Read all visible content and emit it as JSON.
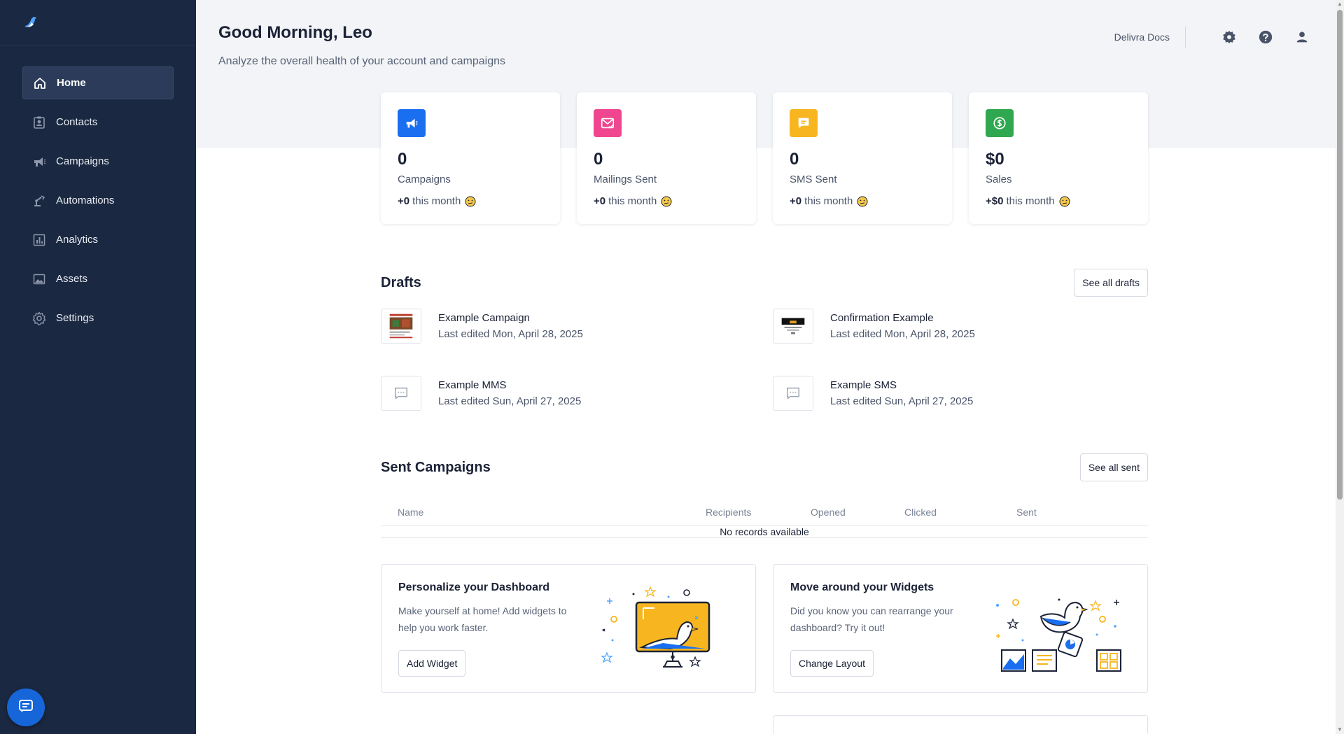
{
  "sidebar": {
    "items": [
      {
        "label": "Home",
        "icon": "home-icon",
        "active": true
      },
      {
        "label": "Contacts",
        "icon": "contacts-icon"
      },
      {
        "label": "Campaigns",
        "icon": "megaphone-icon"
      },
      {
        "label": "Automations",
        "icon": "robot-arm-icon"
      },
      {
        "label": "Analytics",
        "icon": "bar-chart-icon"
      },
      {
        "label": "Assets",
        "icon": "image-icon"
      },
      {
        "label": "Settings",
        "icon": "gear-icon"
      }
    ]
  },
  "header": {
    "greeting": "Good Morning, Leo",
    "subtitle": "Analyze the overall health of your account and campaigns",
    "docs_link": "Delivra Docs"
  },
  "stats": [
    {
      "value": "0",
      "label": "Campaigns",
      "delta": "+0",
      "delta_suffix": "this month",
      "color": "#1a6ff0",
      "icon": "megaphone-icon"
    },
    {
      "value": "0",
      "label": "Mailings Sent",
      "delta": "+0",
      "delta_suffix": "this month",
      "color": "#f0458f",
      "icon": "envelope-icon"
    },
    {
      "value": "0",
      "label": "SMS Sent",
      "delta": "+0",
      "delta_suffix": "this month",
      "color": "#f7b51f",
      "icon": "message-icon"
    },
    {
      "value": "$0",
      "label": "Sales",
      "delta": "+$0",
      "delta_suffix": "this month",
      "color": "#2fa84f",
      "icon": "dollar-icon"
    }
  ],
  "drafts": {
    "title": "Drafts",
    "see_all": "See all drafts",
    "items": [
      {
        "name": "Example Campaign",
        "date": "Last edited Mon, April 28, 2025"
      },
      {
        "name": "Confirmation Example",
        "date": "Last edited Mon, April 28, 2025"
      },
      {
        "name": "Example MMS",
        "date": "Last edited Sun, April 27, 2025"
      },
      {
        "name": "Example SMS",
        "date": "Last edited Sun, April 27, 2025"
      }
    ]
  },
  "sent": {
    "title": "Sent Campaigns",
    "see_all": "See all sent",
    "columns": [
      "Name",
      "Recipients",
      "Opened",
      "Clicked",
      "Sent"
    ],
    "empty": "No records available"
  },
  "promos": [
    {
      "title": "Personalize your Dashboard",
      "text": "Make yourself at home! Add widgets to help you work faster.",
      "button": "Add Widget"
    },
    {
      "title": "Move around your Widgets",
      "text": "Did you know you can rearrange your dashboard? Try it out!",
      "button": "Change Layout"
    }
  ]
}
